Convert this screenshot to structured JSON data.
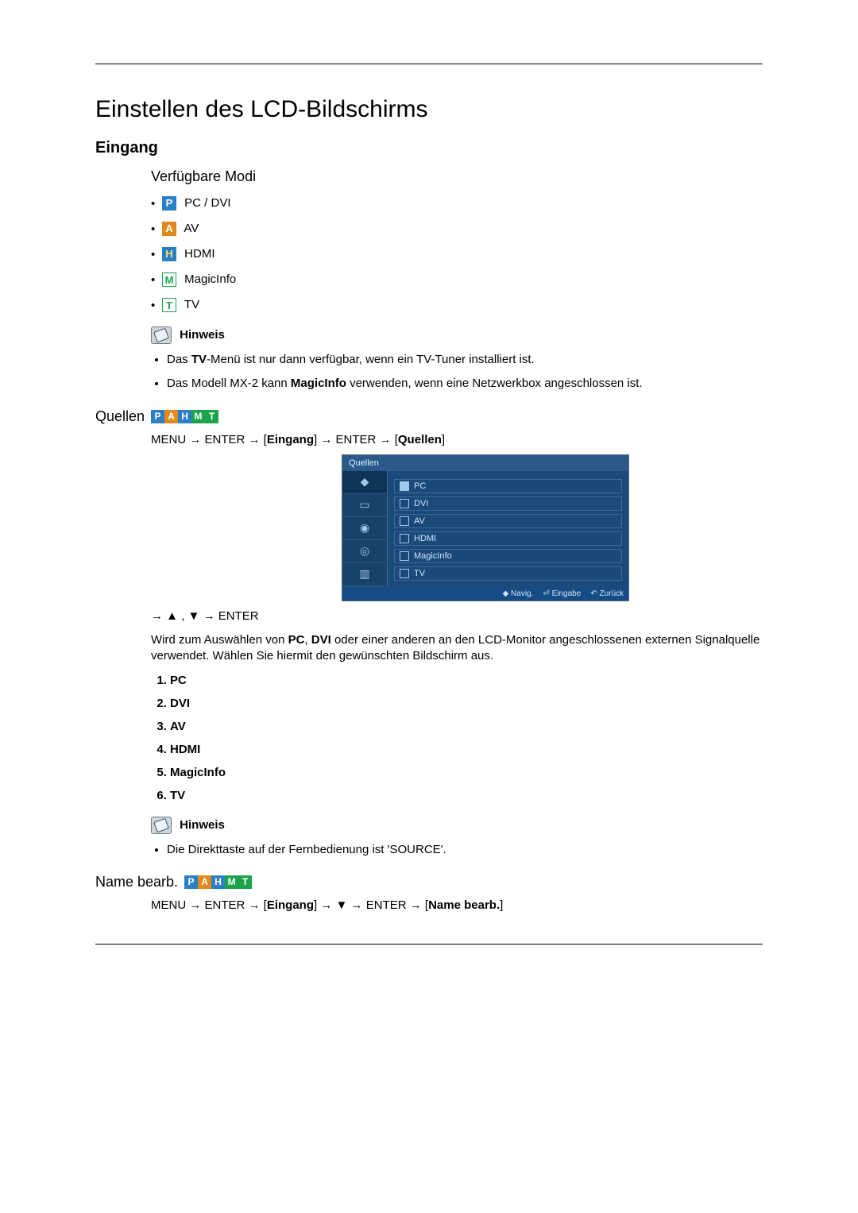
{
  "title": "Einstellen des LCD-Bildschirms",
  "sections": {
    "eingang": {
      "heading": "Eingang",
      "subheading": "Verfügbare Modi",
      "modes": {
        "pc_dvi": "PC / DVI",
        "av": "AV",
        "hdmi": "HDMI",
        "magicinfo": "MagicInfo",
        "tv": "TV"
      },
      "hinweis_label": "Hinweis",
      "hinweis_items": {
        "i1_pre": "Das ",
        "i1_bold": "TV",
        "i1_post": "-Menü ist nur dann verfügbar, wenn ein TV-Tuner installiert ist.",
        "i2_pre": "Das Modell MX-2 kann ",
        "i2_bold": "MagicInfo",
        "i2_post": " verwenden, wenn eine Netzwerkbox angeschlossen ist."
      }
    },
    "quellen": {
      "heading": "Quellen",
      "menu_path": {
        "p1": "MENU → ENTER → [",
        "b1": "Eingang",
        "p2": "] → ENTER → [",
        "b2": "Quellen",
        "p3": "]"
      },
      "osd": {
        "title": "Quellen",
        "items": [
          "PC",
          "DVI",
          "AV",
          "HDMI",
          "MagicInfo",
          "TV"
        ],
        "footer": {
          "navig": "Navig.",
          "eingabe": "Eingabe",
          "zurueck": "Zurück"
        }
      },
      "nav_line": {
        "p1": "→ ",
        "p2": " , ",
        "p3": " → ENTER"
      },
      "description": {
        "pre": "Wird zum Auswählen von ",
        "b1": "PC",
        "mid1": ", ",
        "b2": "DVI",
        "post": " oder einer anderen an den LCD-Monitor angeschlossenen externen Signalquelle verwendet. Wählen Sie hiermit den gewünschten Bildschirm aus."
      },
      "list": [
        "PC",
        "DVI",
        "AV",
        "HDMI",
        "MagicInfo",
        "TV"
      ],
      "hinweis_label": "Hinweis",
      "hinweis2": "Die Direkttaste auf der Fernbedienung ist 'SOURCE'."
    },
    "name_bearb": {
      "heading": "Name bearb.",
      "menu_path": {
        "p1": "MENU → ENTER → [",
        "b1": "Eingang",
        "p2": "] → ",
        "p3": " → ENTER → [",
        "b2": "Name bearb.",
        "p4": "]"
      }
    }
  }
}
